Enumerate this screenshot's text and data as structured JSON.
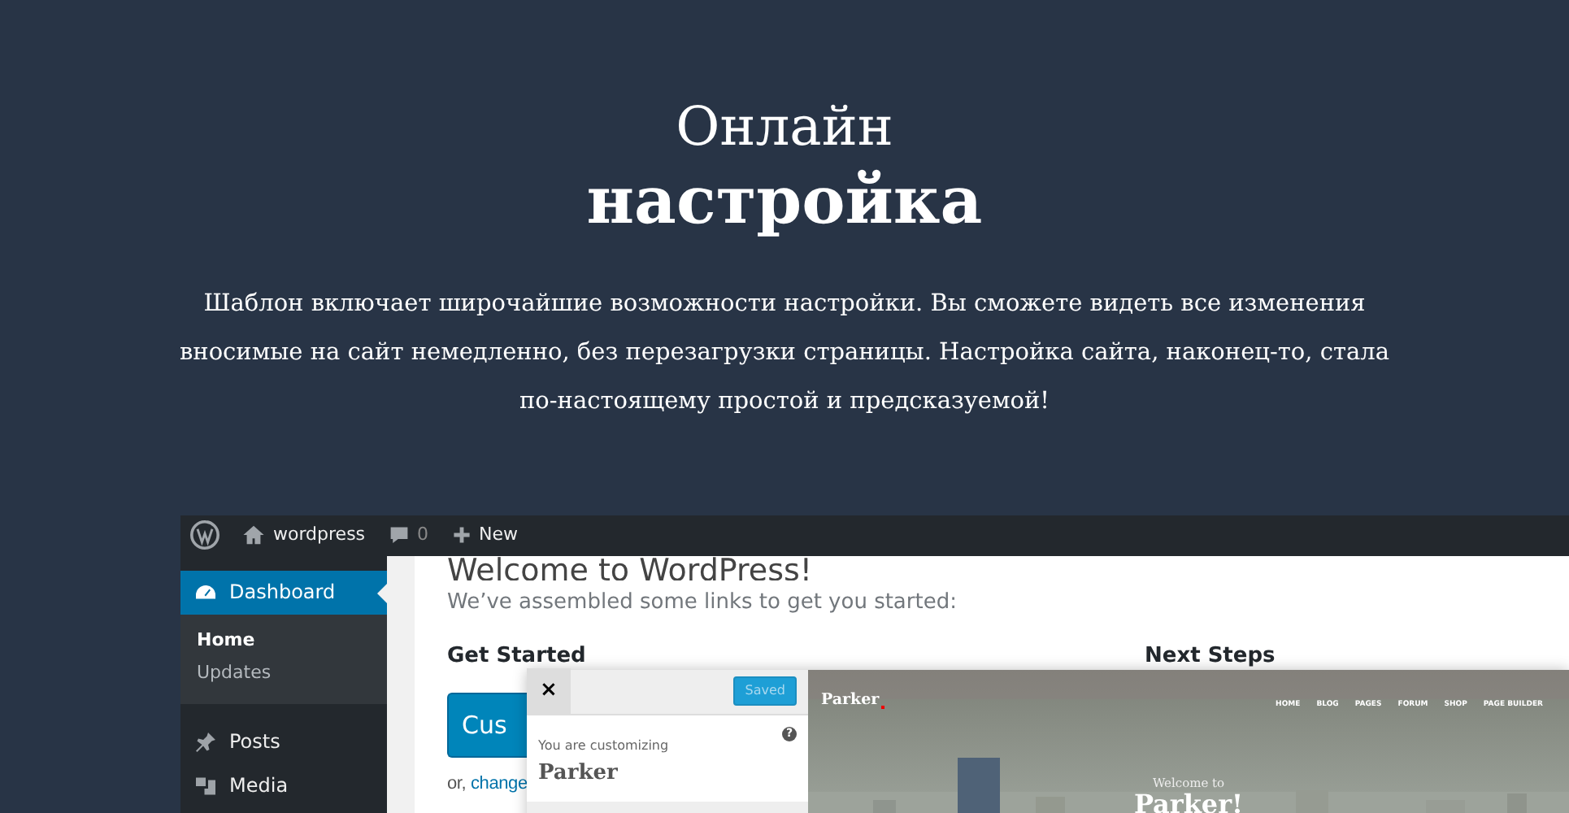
{
  "hero": {
    "title_light": "Онлайн",
    "title_bold": "настройка",
    "description": "Шаблон включает широчайшие возможности настройки. Вы сможете видеть все изменения вносимые на сайт немедленно, без перезагрузки страницы. Настройка сайта, наконец-то, стала по-настоящему простой и предсказуемой!"
  },
  "admin_bar": {
    "site_name": "wordpress",
    "comments_count": "0",
    "new_label": "New"
  },
  "sidebar": {
    "items": [
      {
        "label": "Dashboard",
        "selected": true,
        "children": [
          {
            "label": "Home",
            "selected": true
          },
          {
            "label": "Updates",
            "selected": false
          }
        ]
      },
      {
        "label": "Posts",
        "selected": false
      },
      {
        "label": "Media",
        "selected": false
      }
    ]
  },
  "welcome": {
    "title": "Welcome to WordPress!",
    "subtitle": "We’ve assembled some links to get you started:",
    "get_started": "Get Started",
    "button": "Cus",
    "link_prefix": "or,",
    "link": "change",
    "next_steps": "Next Steps"
  },
  "customizer": {
    "close": "×",
    "status": "Saved",
    "caption": "You are customizing",
    "theme": "Parker",
    "help": "?"
  },
  "preview": {
    "logo": "Parker",
    "nav": [
      "HOME",
      "BLOG",
      "PAGES",
      "FORUM",
      "SHOP",
      "PAGE BUILDER"
    ],
    "kicker": "Welcome to",
    "headline": "Parker!"
  }
}
